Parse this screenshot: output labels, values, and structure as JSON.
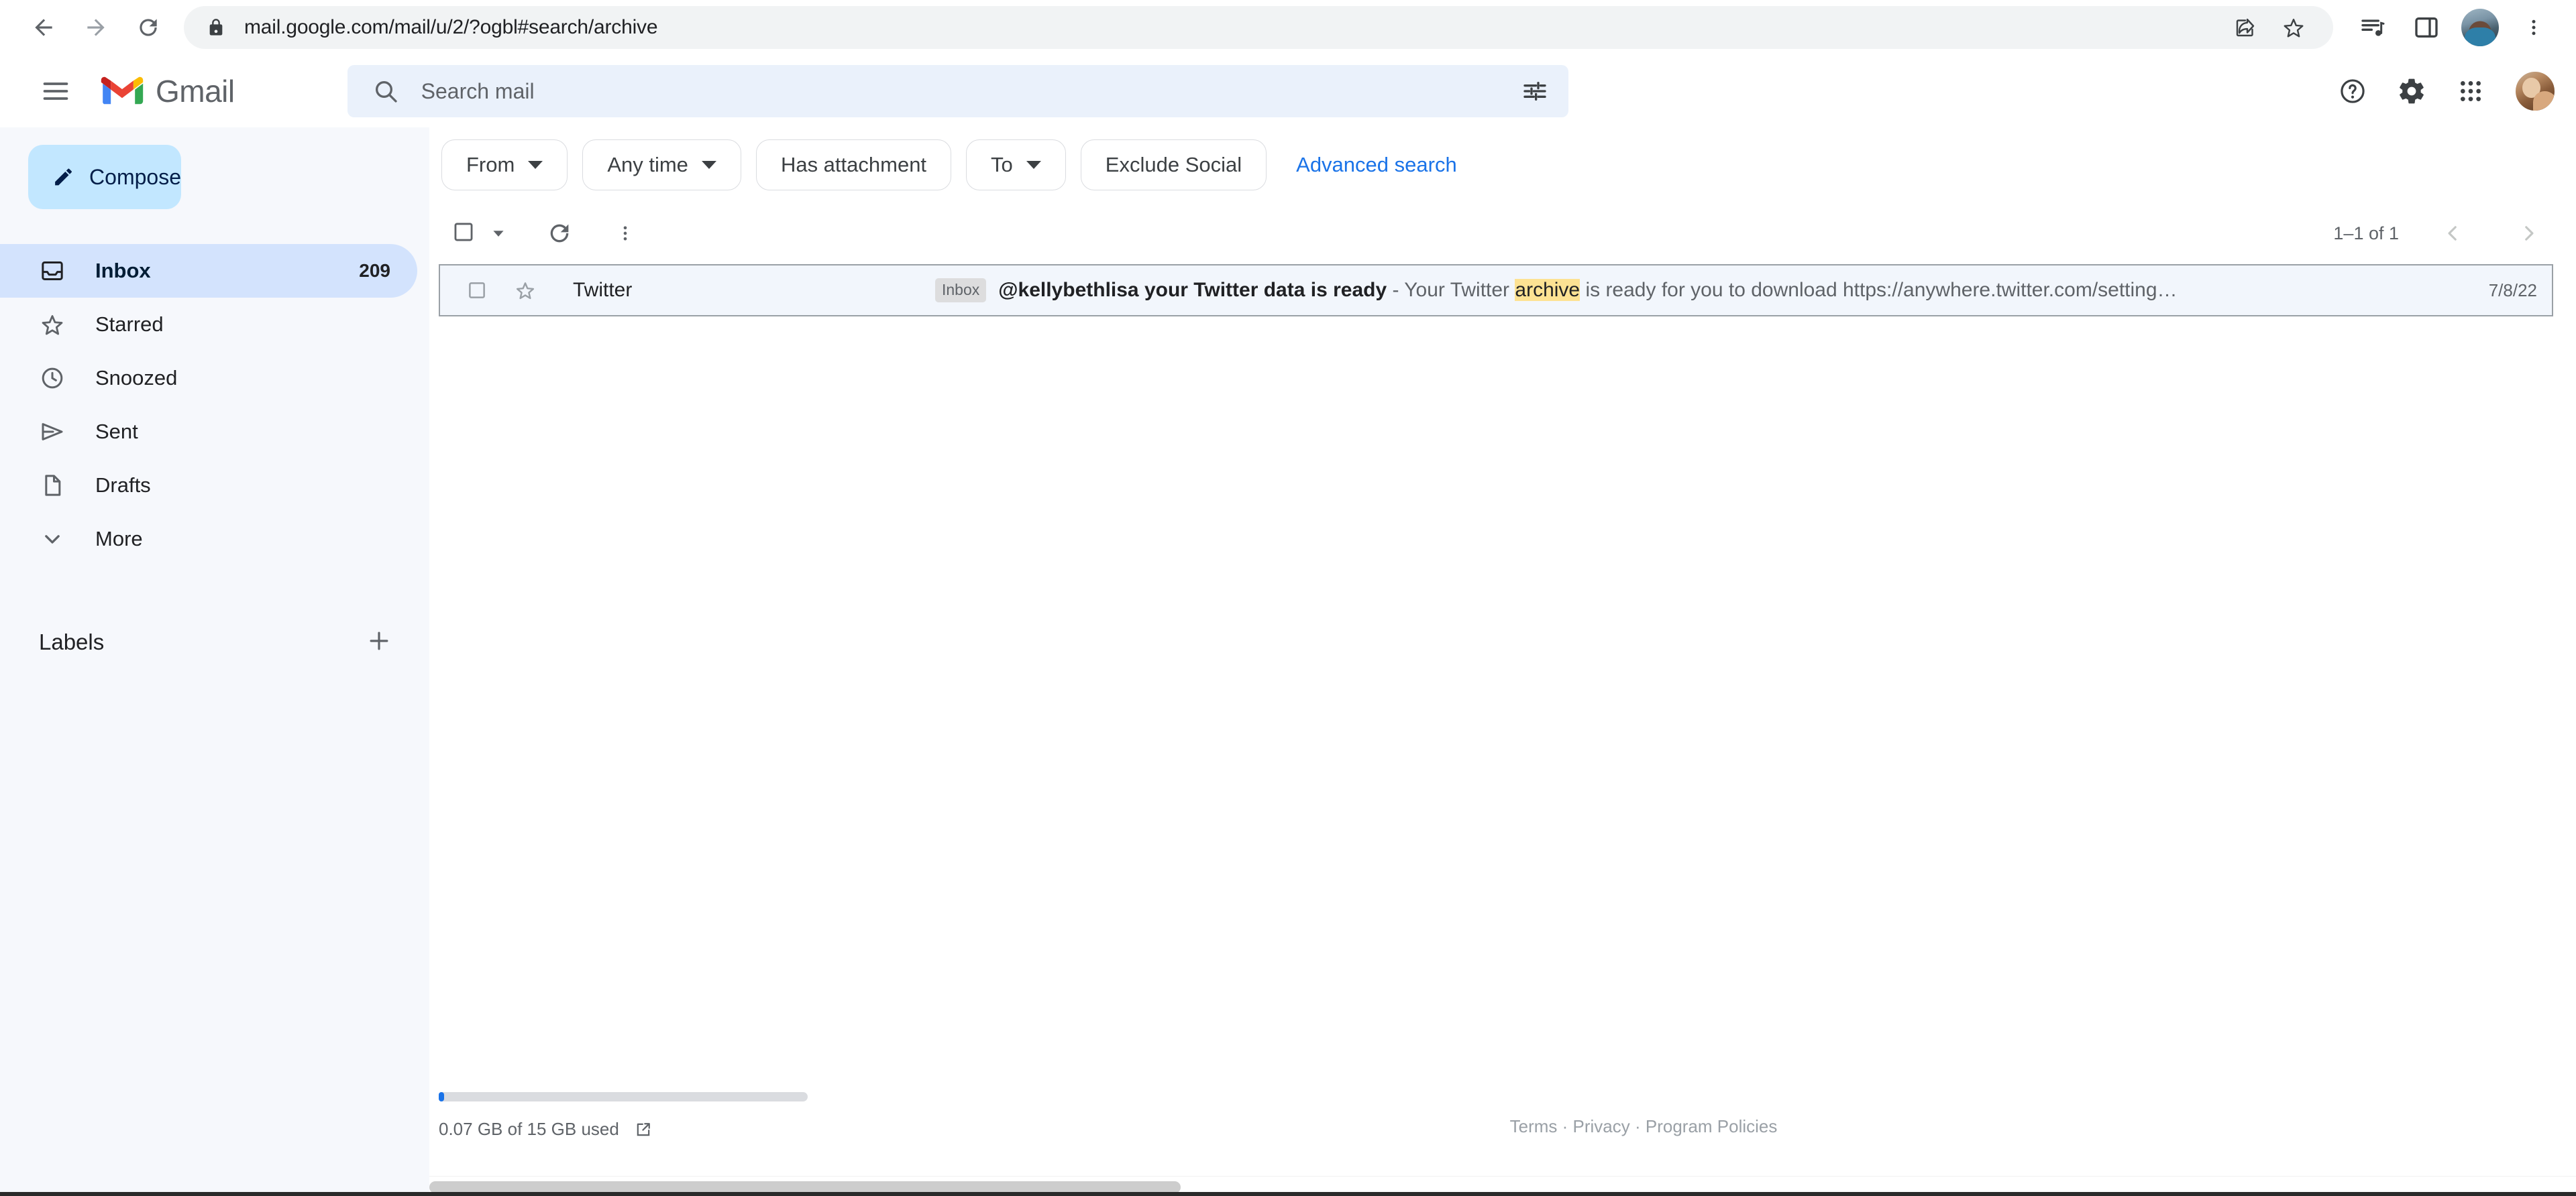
{
  "browser": {
    "url": "mail.google.com/mail/u/2/?ogbl#search/archive",
    "back_label": "Back",
    "forward_label": "Forward",
    "reload_label": "Reload",
    "lock_label": "Site information",
    "share_label": "Share this page",
    "bookmark_label": "Bookmark this tab",
    "reading_list_label": "Reading list",
    "side_panel_label": "Side panel",
    "profile_label": "Profile",
    "menu_label": "Customize and control Chrome"
  },
  "header": {
    "menu_label": "Main menu",
    "brand": "Gmail",
    "search": {
      "placeholder": "Search mail",
      "value": "",
      "search_icon_label": "Search",
      "options_label": "Show search options"
    },
    "support_label": "Support",
    "settings_label": "Settings",
    "apps_label": "Google apps",
    "account_label": "Google Account"
  },
  "sidebar": {
    "compose": {
      "label": "Compose",
      "icon": "pencil-icon"
    },
    "items": [
      {
        "label": "Inbox",
        "icon": "inbox-icon",
        "count": "209",
        "selected": true
      },
      {
        "label": "Starred",
        "icon": "star-icon",
        "count": "",
        "selected": false
      },
      {
        "label": "Snoozed",
        "icon": "clock-icon",
        "count": "",
        "selected": false
      },
      {
        "label": "Sent",
        "icon": "send-icon",
        "count": "",
        "selected": false
      },
      {
        "label": "Drafts",
        "icon": "document-icon",
        "count": "",
        "selected": false
      },
      {
        "label": "More",
        "icon": "chevron-down-icon",
        "count": "",
        "selected": false
      }
    ],
    "labels": {
      "title": "Labels",
      "add_label": "Create new label"
    }
  },
  "filters": {
    "chips": [
      {
        "label": "From",
        "has_caret": true
      },
      {
        "label": "Any time",
        "has_caret": true
      },
      {
        "label": "Has attachment",
        "has_caret": false
      },
      {
        "label": "To",
        "has_caret": true
      },
      {
        "label": "Exclude Social",
        "has_caret": false
      }
    ],
    "advanced_search": "Advanced search"
  },
  "toolbar": {
    "select_all_label": "Select",
    "select_dropdown_label": "Select options",
    "refresh_label": "Refresh",
    "more_label": "More",
    "pager_text": "1–1 of 1",
    "prev_label": "Newer",
    "next_label": "Older"
  },
  "mail_list": {
    "rows": [
      {
        "sender": "Twitter",
        "label_chip": "Inbox",
        "subject": "@kellybethlisa your Twitter data is ready",
        "separator": " - ",
        "snippet_before": "Your Twitter ",
        "highlight": "archive",
        "snippet_after": " is ready for you to download https://anywhere.twitter.com/setting…",
        "date": "7/8/22",
        "checkbox_label": "Select",
        "star_label": "Not starred"
      }
    ]
  },
  "footer": {
    "storage_text": "0.07 GB of 15 GB used",
    "storage_link_label": "Manage storage",
    "links": [
      {
        "label": "Terms"
      },
      {
        "label": "Privacy"
      },
      {
        "label": "Program Policies"
      }
    ],
    "separator": " · "
  },
  "colors": {
    "accent_blue": "#1a73e8",
    "compose_bg": "#c2e7ff",
    "search_bg": "#eaf1fb",
    "sidebar_bg": "#f6f8fc",
    "highlight": "#fde293",
    "selected_nav": "#d3e3fd"
  }
}
